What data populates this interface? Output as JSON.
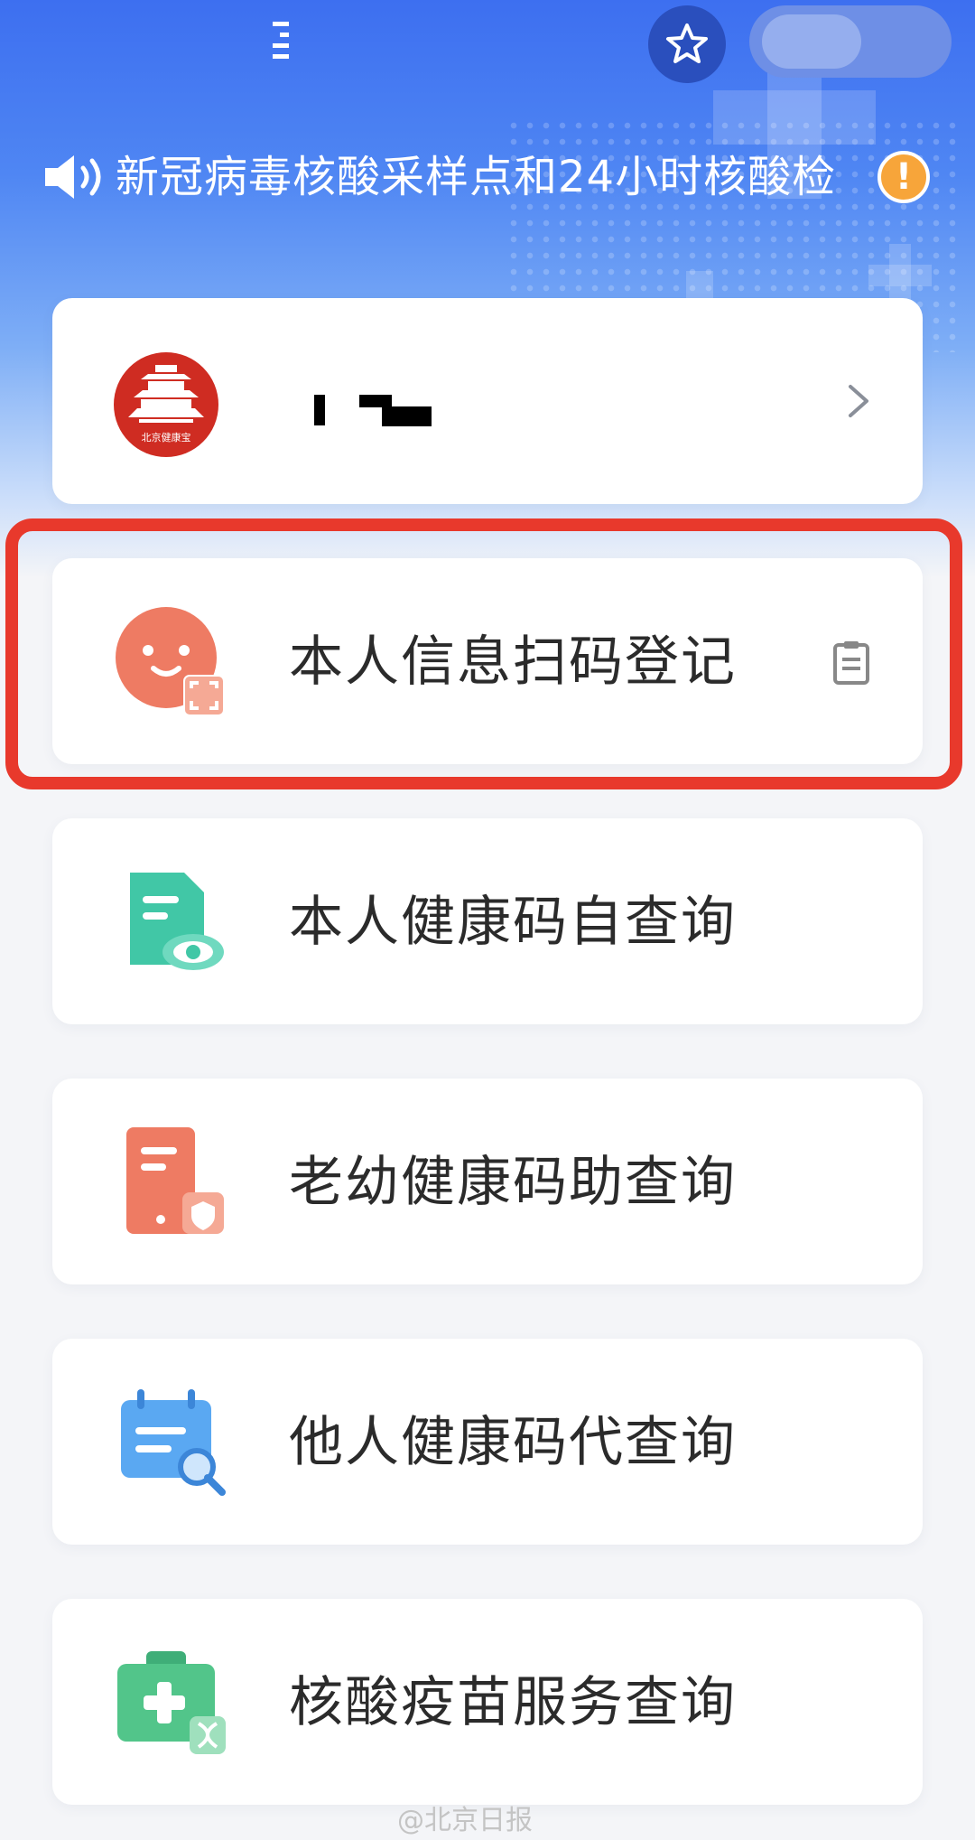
{
  "header": {
    "star_icon": "star-icon",
    "accent_color": "#3d6ff0"
  },
  "notice": {
    "text": "新冠病毒核酸采样点和24小时核酸检",
    "speaker_icon": "speaker-icon",
    "warning_symbol": "!"
  },
  "profile": {
    "logo_text": "北京健康宝",
    "chevron_icon": "chevron-right-icon"
  },
  "menu": [
    {
      "label": "本人信息扫码登记",
      "icon": "face-scan-icon",
      "highlighted": true
    },
    {
      "label": "本人健康码自查询",
      "icon": "document-eye-icon"
    },
    {
      "label": "老幼健康码助查询",
      "icon": "phone-shield-icon"
    },
    {
      "label": "他人健康码代查询",
      "icon": "calendar-search-icon"
    },
    {
      "label": "核酸疫苗服务查询",
      "icon": "medical-kit-icon"
    }
  ],
  "highlight_color": "#e8392c",
  "watermark": "@北京日报"
}
